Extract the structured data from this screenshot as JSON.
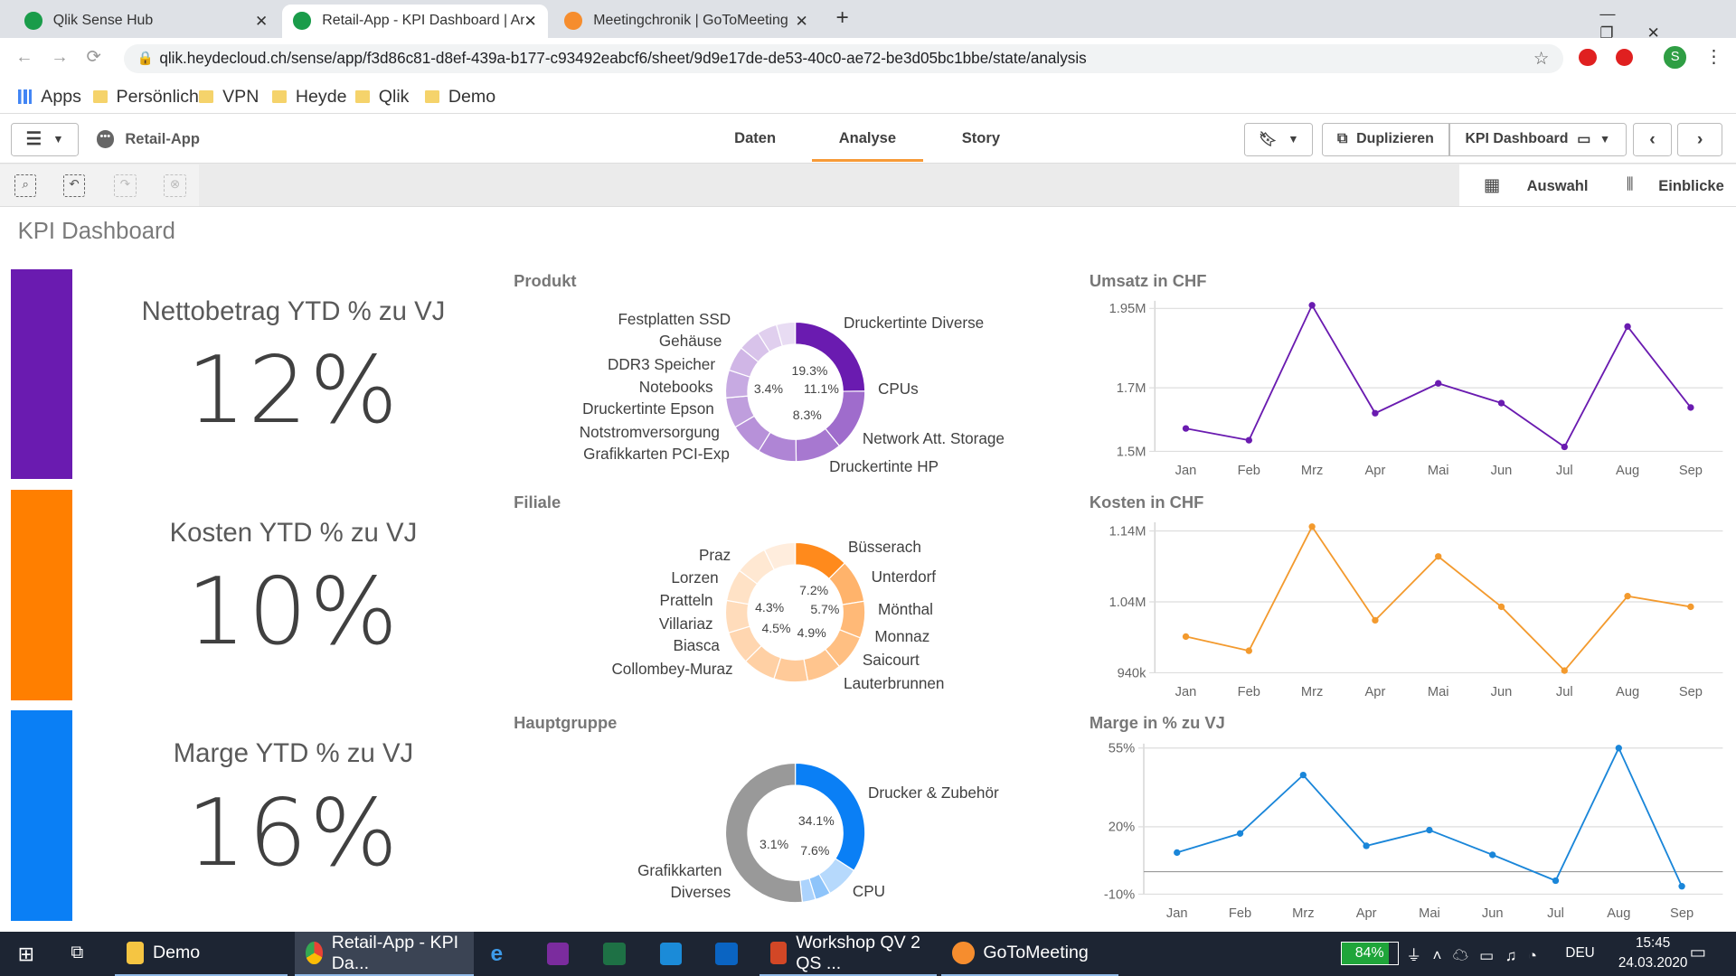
{
  "browser": {
    "tabs": [
      {
        "title": "Qlik Sense Hub",
        "active": false
      },
      {
        "title": "Retail-App - KPI Dashboard | Ana",
        "active": true
      },
      {
        "title": "Meetingchronik | GoToMeeting",
        "active": false
      }
    ],
    "url": "qlik.heydecloud.ch/sense/app/f3d86c81-d8ef-439a-b177-c93492eabcf6/sheet/9d9e17de-de53-40c0-ae72-be3d05bc1bbe/state/analysis",
    "profile_initial": "S",
    "bookmarks": [
      "Apps",
      "Persönlich",
      "VPN",
      "Heyde",
      "Qlik",
      "Demo"
    ]
  },
  "qlik": {
    "app_name": "Retail-App",
    "nav_tabs": [
      {
        "label": "Daten",
        "active": false
      },
      {
        "label": "Analyse",
        "active": true
      },
      {
        "label": "Story",
        "active": false
      }
    ],
    "duplicate_label": "Duplizieren",
    "sheet_selector": "KPI Dashboard",
    "selections_label": "Auswahl",
    "insights_label": "Einblicke",
    "accent": "#f79a37"
  },
  "sheet": {
    "title": "KPI Dashboard",
    "kpis": [
      {
        "title": "Nettobetrag YTD % zu VJ",
        "value": "12%",
        "color": "#6a1bb0"
      },
      {
        "title": "Kosten YTD % zu VJ",
        "value": "10%",
        "color": "#ff7f00"
      },
      {
        "title": "Marge YTD % zu VJ",
        "value": "16%",
        "color": "#0a7ff5"
      }
    ]
  },
  "chart_data": [
    {
      "type": "pie",
      "title": "Produkt",
      "donut": true,
      "color": "#6a1bb0",
      "slices": [
        {
          "name": "Druckertinte Diverse",
          "pct": 19.3,
          "label": "19.3%"
        },
        {
          "name": "CPUs",
          "pct": 11.1,
          "label": "11.1%"
        },
        {
          "name": "Network Att. Storage",
          "pct": 8.3,
          "label": "8.3%"
        },
        {
          "name": "Druckertinte HP",
          "pct": 7.0
        },
        {
          "name": "Grafikkarten PCI-Exp",
          "pct": 6.0
        },
        {
          "name": "Notstromversorgung",
          "pct": 5.5
        },
        {
          "name": "Druckertinte Epson",
          "pct": 5.0
        },
        {
          "name": "Notebooks",
          "pct": 4.5
        },
        {
          "name": "DDR3 Speicher",
          "pct": 4.0
        },
        {
          "name": "Gehäuse",
          "pct": 3.6
        },
        {
          "name": "Festplatten SSD",
          "pct": 3.4,
          "label": "3.4%"
        }
      ]
    },
    {
      "type": "pie",
      "title": "Filiale",
      "donut": true,
      "color": "#ff8a1c",
      "slices": [
        {
          "name": "Büsserach",
          "pct": 7.2,
          "label": "7.2%"
        },
        {
          "name": "Unterdorf",
          "pct": 5.7,
          "label": "5.7%"
        },
        {
          "name": "Mönthal",
          "pct": 4.9,
          "label": "4.9%"
        },
        {
          "name": "Monnaz",
          "pct": 4.7
        },
        {
          "name": "Saicourt",
          "pct": 4.6
        },
        {
          "name": "Lauterbrunnen",
          "pct": 4.5,
          "label": "4.5%"
        },
        {
          "name": "Collombey-Muraz",
          "pct": 4.4
        },
        {
          "name": "Biasca",
          "pct": 4.4
        },
        {
          "name": "Villariaz",
          "pct": 4.3
        },
        {
          "name": "Pratteln",
          "pct": 4.3
        },
        {
          "name": "Lorzen",
          "pct": 4.3,
          "label": "4.3%"
        },
        {
          "name": "Praz",
          "pct": 4.2
        }
      ]
    },
    {
      "type": "pie",
      "title": "Hauptgruppe",
      "donut": true,
      "color": "#0a7ff5",
      "slices": [
        {
          "name": "Drucker & Zubehör",
          "pct": 34.1,
          "label": "34.1%"
        },
        {
          "name": "CPU",
          "pct": 7.6,
          "label": "7.6%"
        },
        {
          "name": "Diverses",
          "pct": 3.6
        },
        {
          "name": "Grafikkarten",
          "pct": 3.1,
          "label": "3.1%"
        },
        {
          "name": "",
          "pct": 51.6
        }
      ]
    },
    {
      "type": "line",
      "title": "Umsatz in CHF",
      "color": "#6a1bb0",
      "categories": [
        "Jan",
        "Feb",
        "Mrz",
        "Apr",
        "Mai",
        "Jun",
        "Jul",
        "Aug",
        "Sep"
      ],
      "values": [
        1572000,
        1535000,
        1960000,
        1620000,
        1714000,
        1652000,
        1514000,
        1893000,
        1638000
      ],
      "yticks": [
        {
          "v": 1500000,
          "label": "1.5M"
        },
        {
          "v": 1700000,
          "label": "1.7M"
        },
        {
          "v": 1950000,
          "label": "1.95M"
        }
      ],
      "ylim": [
        1500000,
        1960000
      ],
      "grid": true
    },
    {
      "type": "line",
      "title": "Kosten in CHF",
      "color": "#f39a2e",
      "categories": [
        "Jan",
        "Feb",
        "Mrz",
        "Apr",
        "Mai",
        "Jun",
        "Jul",
        "Aug",
        "Sep"
      ],
      "values": [
        991000,
        971000,
        1146000,
        1014000,
        1104000,
        1033000,
        943000,
        1048000,
        1033000
      ],
      "yticks": [
        {
          "v": 940000,
          "label": "940k"
        },
        {
          "v": 1040000,
          "label": "1.04M"
        },
        {
          "v": 1140000,
          "label": "1.14M"
        }
      ],
      "ylim": [
        940000,
        1146000
      ],
      "grid": true
    },
    {
      "type": "line",
      "title": "Marge in % zu VJ",
      "color": "#1a86d9",
      "categories": [
        "Jan",
        "Feb",
        "Mrz",
        "Apr",
        "Mai",
        "Jun",
        "Jul",
        "Aug",
        "Sep"
      ],
      "values": [
        8.5,
        17,
        43,
        11.5,
        18.5,
        7.5,
        -4,
        55,
        -6.5
      ],
      "yticks": [
        {
          "v": -10,
          "label": "-10%"
        },
        {
          "v": 20,
          "label": "20%"
        },
        {
          "v": 55,
          "label": "55%"
        }
      ],
      "ylim": [
        -10,
        55
      ],
      "zero_line": true,
      "grid": true
    }
  ],
  "taskbar": {
    "items": [
      {
        "label": "Demo"
      },
      {
        "label": "Retail-App - KPI Da..."
      },
      {
        "label": "Workshop QV 2 QS ..."
      },
      {
        "label": "GoToMeeting"
      }
    ],
    "battery": "84%",
    "language": "DEU",
    "time": "15:45",
    "date": "24.03.2020"
  }
}
